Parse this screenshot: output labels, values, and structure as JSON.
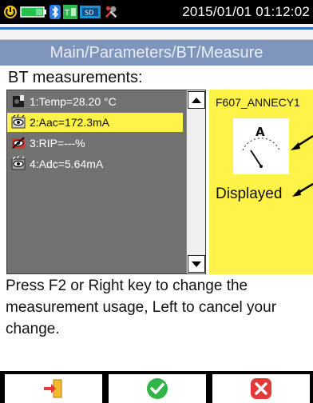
{
  "status_bar": {
    "datetime": "2015/01/01 01:12:02",
    "icons": [
      "power-icon",
      "battery-icon",
      "bluetooth-icon",
      "thermal-icon",
      "sd-card-icon",
      "tools-icon"
    ]
  },
  "title": "Main/Parameters/BT/Measure",
  "section_label": "BT measurements:",
  "measurements": [
    {
      "label": "1:Temp=28.20 °C",
      "icon": "no-sensor-icon",
      "selected": false
    },
    {
      "label": "2:Aac=172.3mA",
      "icon": "display-eye-icon",
      "selected": true
    },
    {
      "label": "3:RIP=---%",
      "icon": "hidden-eye-icon",
      "selected": false
    },
    {
      "label": "4:Adc=5.64mA",
      "icon": "display-eye-icon",
      "selected": false
    }
  ],
  "detail": {
    "device_name": "F607_ANNECY1",
    "gauge_letter": "A",
    "usage": "Displayed"
  },
  "help_text": "Press F2 or Right key to change the measurement usage, Left to cancel your change.",
  "softkeys": [
    {
      "icon": "exit-icon"
    },
    {
      "icon": "confirm-check-icon"
    },
    {
      "icon": "cancel-x-icon"
    }
  ],
  "colors": {
    "title_bar": "#7f95bb",
    "selection": "#fff34a",
    "list_background": "#727272",
    "confirm_green": "#33b449",
    "cancel_red": "#e23a3a"
  }
}
